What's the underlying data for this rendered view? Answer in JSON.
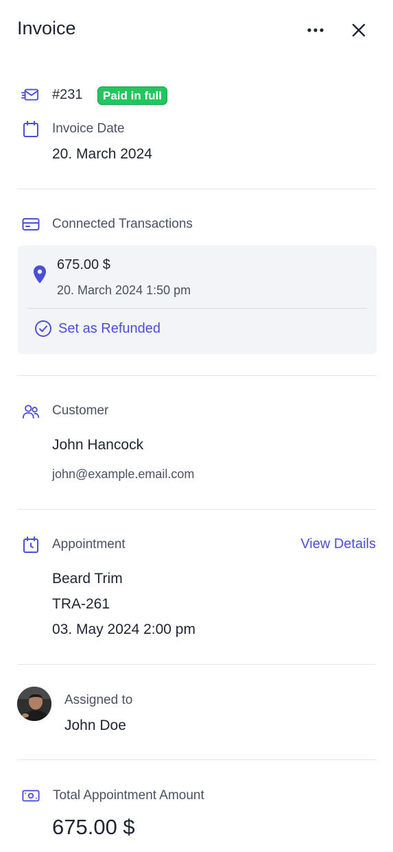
{
  "header": {
    "title": "Invoice",
    "more_icon": "more-horizontal-icon",
    "close_icon": "close-icon"
  },
  "invoice": {
    "number": "#231",
    "status": "Paid in full",
    "date_label": "Invoice Date",
    "date": "20. March 2024"
  },
  "transactions": {
    "label": "Connected Transactions",
    "items": [
      {
        "amount": "675.00 $",
        "datetime": "20. March 2024 1:50 pm",
        "action": "Set as Refunded"
      }
    ]
  },
  "customer": {
    "label": "Customer",
    "name": "John Hancock",
    "email": "john@example.email.com"
  },
  "appointment": {
    "label": "Appointment",
    "view_details": "View Details",
    "service": "Beard Trim",
    "code": "TRA-261",
    "datetime": "03. May 2024 2:00 pm"
  },
  "assignee": {
    "label": "Assigned to",
    "name": "John Doe"
  },
  "total": {
    "label": "Total Appointment Amount",
    "amount": "675.00 $"
  },
  "colors": {
    "accent": "#4a4fd8",
    "paid": "#22c55e",
    "card": "#f3f4f8"
  }
}
